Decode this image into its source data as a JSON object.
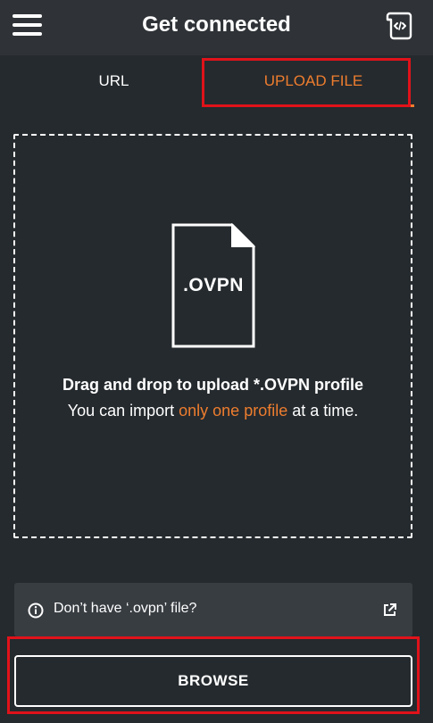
{
  "header": {
    "title": "Get connected",
    "menu_icon": "hamburger-menu-icon",
    "import_icon": "import-profile-icon"
  },
  "tabs": [
    {
      "label": "URL",
      "active": false
    },
    {
      "label": "UPLOAD FILE",
      "active": true
    }
  ],
  "drop_zone": {
    "file_icon_label": ".OVPN",
    "title": "Drag and drop to upload *.OVPN profile",
    "subtitle_before": "You can import ",
    "subtitle_accent": "only one profile",
    "subtitle_after": " at a time."
  },
  "info_bar": {
    "text": "Don’t have ‘.ovpn’ file?",
    "icon": "info-icon",
    "link_icon": "external-link-icon"
  },
  "browse": {
    "label": "BROWSE"
  },
  "colors": {
    "background": "#252a2e",
    "header": "#2f3337",
    "accent": "#ee7d2e",
    "annotation_highlight": "#e0121a"
  }
}
